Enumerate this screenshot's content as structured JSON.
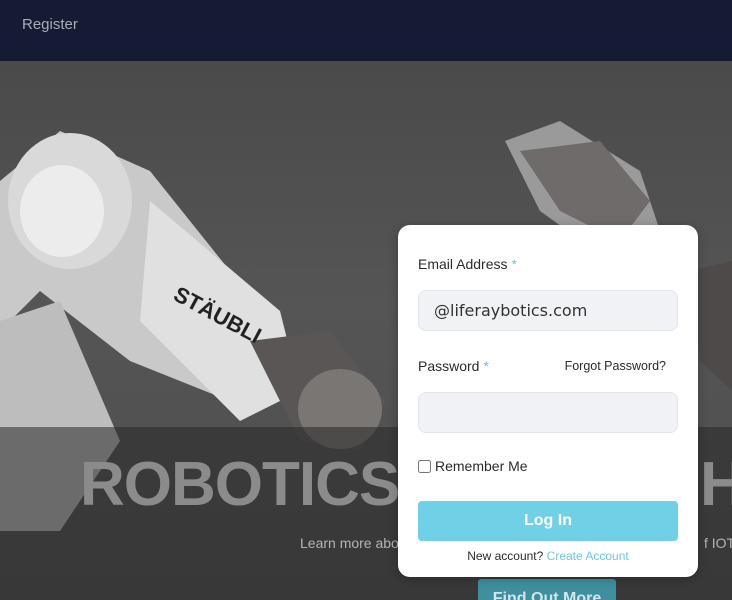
{
  "nav": {
    "register_label": "Register"
  },
  "hero": {
    "title": "ROBOTICS",
    "title_tail": "H",
    "subtitle": "Learn more abo",
    "subtitle_tail": "f IOT",
    "cta_label": "Find Out More",
    "robot_brand": "STÄUBLI"
  },
  "login": {
    "email_label": "Email Address",
    "required_mark": "*",
    "email_value": "@liferaybotics.com",
    "password_label": "Password",
    "forgot_label": "Forgot Password?",
    "password_value": "",
    "remember_label": "Remember Me",
    "remember_checked": false,
    "login_label": "Log In",
    "new_account_text": "New account?",
    "create_account_label": "Create Account"
  },
  "colors": {
    "nav_bg": "#141b33",
    "accent": "#6fd0e6",
    "link": "#6cc8dc",
    "cta_bg": "#3f8f9e"
  }
}
